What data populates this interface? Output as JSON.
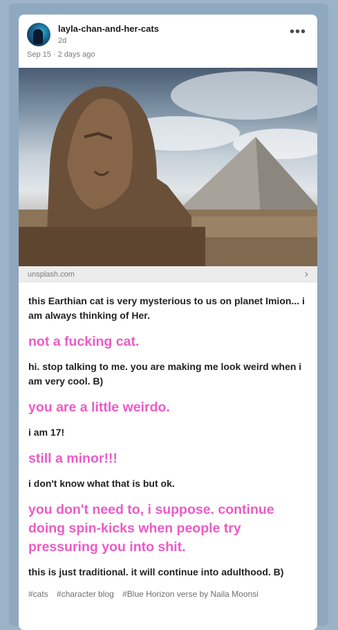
{
  "post": {
    "username": "layla-chan-and-her-cats",
    "relative_time": "2d",
    "date_line": "Sep 15 · 2 days ago",
    "menu_label": "•••"
  },
  "link": {
    "source": "unsplash.com",
    "chevron": "›"
  },
  "messages": [
    {
      "style": "black",
      "text": "this Earthian cat is very mysterious to us on planet Imion... i am always thinking of Her."
    },
    {
      "style": "pink",
      "text": "not a fucking cat."
    },
    {
      "style": "black",
      "text": "hi. stop talking to me. you are making me look weird when i am very cool. B)"
    },
    {
      "style": "pink",
      "text": "you are a little weirdo."
    },
    {
      "style": "black",
      "text": "i am 17!"
    },
    {
      "style": "pink",
      "text": "still a minor!!!"
    },
    {
      "style": "black",
      "text": "i don't know what that is but ok."
    },
    {
      "style": "pink",
      "text": "you don't need to, i suppose. continue doing spin-kicks when people try pressuring you into shit."
    },
    {
      "style": "black",
      "text": "this is just traditional. it will continue into adulthood. B)"
    }
  ],
  "tags": [
    "#cats",
    "#character blog",
    "#Blue Horizon verse by Naila Moonsi"
  ],
  "colors": {
    "pink": "#ec5bc8",
    "background": "#9cb2c6"
  },
  "icons": {
    "menu": "more-horizontal-icon",
    "link": "chevron-right-icon"
  }
}
